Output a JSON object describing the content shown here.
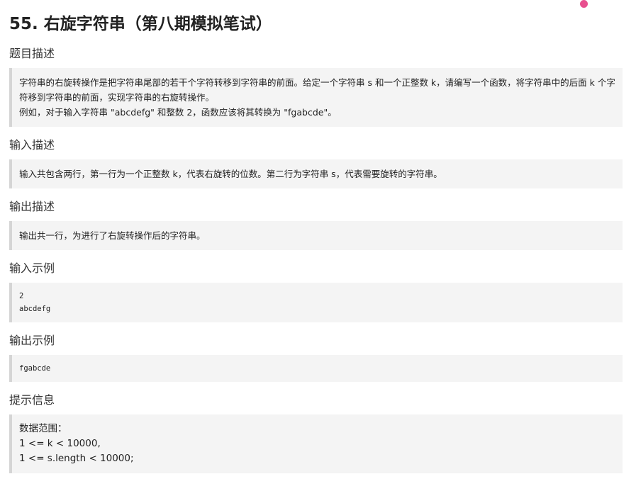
{
  "page": {
    "title": "55. 右旋字符串（第八期模拟笔试）"
  },
  "sections": {
    "description": {
      "heading": "题目描述",
      "lines": [
        "字符串的右旋转操作是把字符串尾部的若干个字符转移到字符串的前面。给定一个字符串 s 和一个正整数 k，请编写一个函数，将字符串中的后面 k 个字符移到字符串的前面，实现字符串的右旋转操作。",
        "例如，对于输入字符串 \"abcdefg\" 和整数 2，函数应该将其转换为 \"fgabcde\"。"
      ]
    },
    "input_desc": {
      "heading": "输入描述",
      "text": "输入共包含两行，第一行为一个正整数 k，代表右旋转的位数。第二行为字符串 s，代表需要旋转的字符串。"
    },
    "output_desc": {
      "heading": "输出描述",
      "text": "输出共一行，为进行了右旋转操作后的字符串。"
    },
    "input_example": {
      "heading": "输入示例",
      "lines": [
        "2",
        "abcdefg"
      ]
    },
    "output_example": {
      "heading": "输出示例",
      "lines": [
        "fgabcde"
      ]
    },
    "hint": {
      "heading": "提示信息",
      "lines": [
        "数据范围：",
        "1 <= k < 10000,",
        "1 <= s.length < 10000;"
      ]
    }
  },
  "colors": {
    "accent_dot": "#e8508f",
    "block_background": "#f4f4f4",
    "block_border": "#d5d5d5"
  }
}
